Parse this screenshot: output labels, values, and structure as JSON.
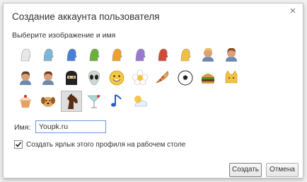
{
  "dialog": {
    "title": "Создание аккаунта пользователя",
    "close_glyph": "×",
    "subtitle": "Выберите изображение и имя"
  },
  "avatars": [
    {
      "icon": "avatar-white-head-icon",
      "color": "#e8e8e8"
    },
    {
      "icon": "avatar-cyan-head-icon",
      "color": "#7fb5d6"
    },
    {
      "icon": "avatar-blue-head-icon",
      "color": "#4a7fd6"
    },
    {
      "icon": "avatar-green-head-icon",
      "color": "#6ab03a"
    },
    {
      "icon": "avatar-orange-head-icon",
      "color": "#f0a030"
    },
    {
      "icon": "avatar-purple-head-icon",
      "color": "#9a7ad0"
    },
    {
      "icon": "avatar-red-head-icon",
      "color": "#d04a3a"
    },
    {
      "icon": "avatar-yellow-head-icon",
      "color": "#f0c040"
    },
    {
      "icon": "avatar-blonde-woman-icon",
      "color": "#e8c060"
    },
    {
      "icon": "avatar-hero-man-icon",
      "color": "#8a4a20"
    },
    {
      "icon": "avatar-sunglasses-woman-icon",
      "color": "#5a3a20"
    },
    {
      "icon": "avatar-dark-man-icon",
      "color": "#6a3a1a"
    },
    {
      "icon": "avatar-ninja-icon",
      "color": "#222222"
    },
    {
      "icon": "avatar-alien-icon",
      "color": "#cfd8d0"
    },
    {
      "icon": "avatar-smiley-icon",
      "color": "#f5c842"
    },
    {
      "icon": "avatar-flower-icon",
      "color": "#f5f5f5"
    },
    {
      "icon": "avatar-pizza-icon",
      "color": "#e8b060"
    },
    {
      "icon": "avatar-soccer-ball-icon",
      "color": "#ffffff"
    },
    {
      "icon": "avatar-burger-icon",
      "color": "#b8702a"
    },
    {
      "icon": "avatar-cat-icon",
      "color": "#f5c040"
    },
    {
      "icon": "avatar-cupcake-icon",
      "color": "#f0c8a0"
    },
    {
      "icon": "avatar-dog-icon",
      "color": "#e0a860"
    },
    {
      "icon": "avatar-horse-icon",
      "color": "#5a2e18"
    },
    {
      "icon": "avatar-cocktail-icon",
      "color": "#a8d8d0"
    },
    {
      "icon": "avatar-music-note-icon",
      "color": "#2a58c8"
    },
    {
      "icon": "avatar-sun-cloud-icon",
      "color": "#f5c842"
    }
  ],
  "selected_avatar_index": 22,
  "name": {
    "label": "Имя:",
    "value": "Youpk.ru"
  },
  "shortcut": {
    "checked": true,
    "label": "Создать ярлык этого профиля на рабочем столе"
  },
  "buttons": {
    "create": "Создать",
    "cancel": "Отмена"
  }
}
